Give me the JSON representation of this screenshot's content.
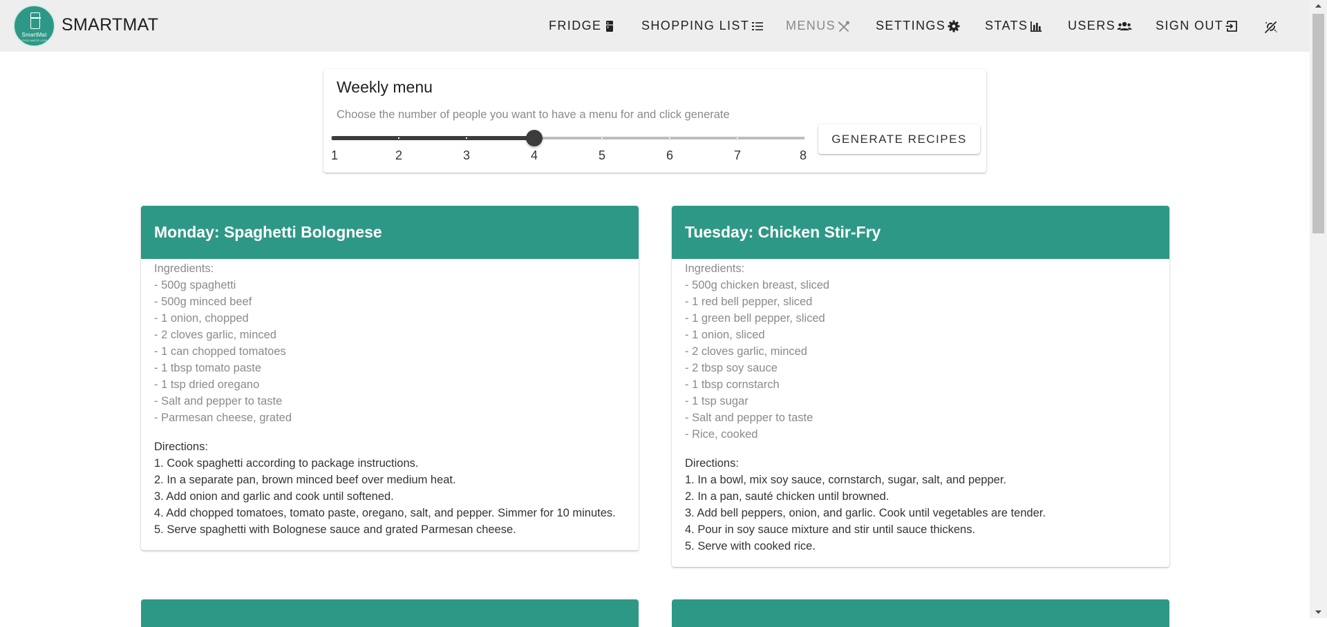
{
  "app": {
    "brand": "SMARTMAT",
    "logo_text": "SmartMat",
    "logo_subtext": "FOOD WASTE LESS"
  },
  "nav": {
    "fridge": "FRIDGE",
    "shopping_list": "SHOPPING LIST",
    "menus": "MENUS",
    "settings": "SETTINGS",
    "stats": "STATS",
    "users": "USERS",
    "sign_out": "SIGN OUT",
    "active": "menus"
  },
  "weekly_menu": {
    "title": "Weekly menu",
    "subtitle": "Choose the number of people you want to have a menu for and click generate",
    "slider": {
      "min": 1,
      "max": 8,
      "value": 4,
      "labels": [
        "1",
        "2",
        "3",
        "4",
        "5",
        "6",
        "7",
        "8"
      ]
    },
    "generate_label": "GENERATE RECIPES"
  },
  "recipes": [
    {
      "title": "Monday: Spaghetti Bolognese",
      "ingredients_label": "Ingredients:",
      "ingredients": [
        "- 500g spaghetti",
        "- 500g minced beef",
        "- 1 onion, chopped",
        "- 2 cloves garlic, minced",
        "- 1 can chopped tomatoes",
        "- 1 tbsp tomato paste",
        "- 1 tsp dried oregano",
        "- Salt and pepper to taste",
        "- Parmesan cheese, grated"
      ],
      "directions_label": "Directions:",
      "directions": [
        "1. Cook spaghetti according to package instructions.",
        "2. In a separate pan, brown minced beef over medium heat.",
        "3. Add onion and garlic and cook until softened.",
        "4. Add chopped tomatoes, tomato paste, oregano, salt, and pepper. Simmer for 10 minutes.",
        "5. Serve spaghetti with Bolognese sauce and grated Parmesan cheese."
      ]
    },
    {
      "title": "Tuesday: Chicken Stir-Fry",
      "ingredients_label": "Ingredients:",
      "ingredients": [
        "- 500g chicken breast, sliced",
        "- 1 red bell pepper, sliced",
        "- 1 green bell pepper, sliced",
        "- 1 onion, sliced",
        "- 2 cloves garlic, minced",
        "- 2 tbsp soy sauce",
        "- 1 tbsp cornstarch",
        "- 1 tsp sugar",
        "- Salt and pepper to taste",
        "- Rice, cooked"
      ],
      "directions_label": "Directions:",
      "directions": [
        "1. In a bowl, mix soy sauce, cornstarch, sugar, salt, and pepper.",
        "2. In a pan, sauté chicken until browned.",
        "3. Add bell peppers, onion, and garlic. Cook until vegetables are tender.",
        "4. Pour in soy sauce mixture and stir until sauce thickens.",
        "5. Serve with cooked rice."
      ]
    }
  ],
  "colors": {
    "accent": "#2e9886",
    "appbar_bg": "#eeeeee",
    "slider_active": "#3c3c3c",
    "muted_text": "#8a8a8a"
  },
  "icons": {
    "fridge": "fridge-icon",
    "shopping_list": "list-icon",
    "menus": "utensils-icon",
    "settings": "gear-icon",
    "stats": "bar-chart-icon",
    "users": "users-icon",
    "sign_out": "sign-out-icon",
    "theme": "theme-toggle-icon"
  }
}
